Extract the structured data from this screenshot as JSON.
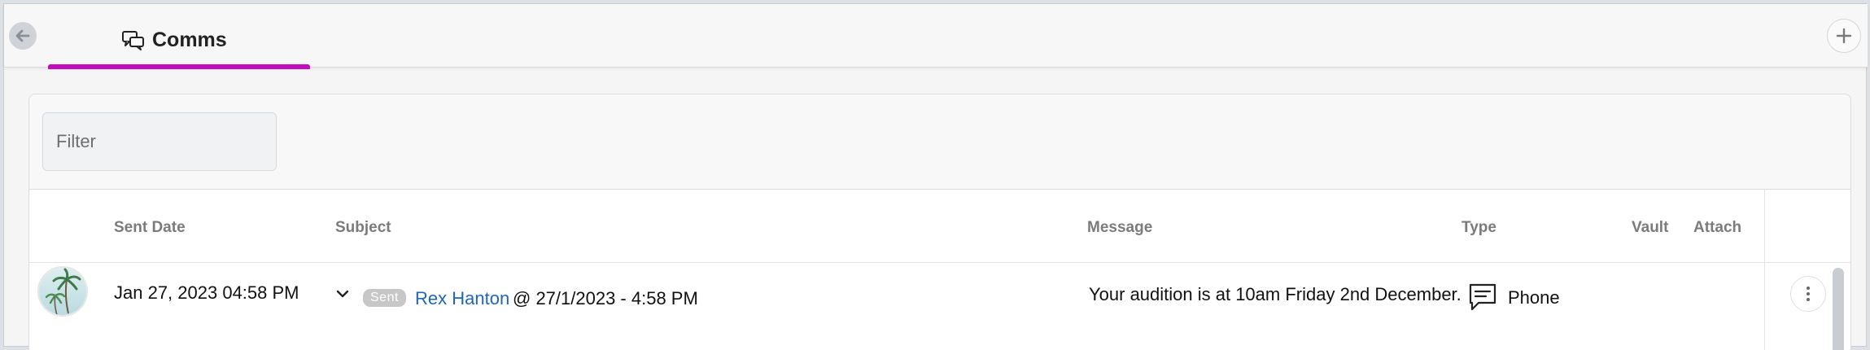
{
  "tabs": [
    {
      "label": "Comms",
      "active": true,
      "icon": "chat-bubbles-icon"
    }
  ],
  "colors": {
    "accent": "#c20dbf",
    "link": "#1f66b7"
  },
  "filter": {
    "placeholder": "Filter",
    "value": ""
  },
  "table": {
    "headers": {
      "sent_date": "Sent Date",
      "subject": "Subject",
      "message": "Message",
      "type": "Type",
      "vault": "Vault",
      "attach": "Attach"
    },
    "rows": [
      {
        "sent_date": "Jan 27, 2023 04:58 PM",
        "status": "Sent",
        "recipient": "Rex Hanton",
        "subject_suffix": "@ 27/1/2023 - 4:58 PM",
        "message": "Your audition is at 10am Friday 2nd December.",
        "type": "Phone",
        "type_icon": "chat-message-icon",
        "avatar": "palm-trees-avatar"
      }
    ]
  }
}
